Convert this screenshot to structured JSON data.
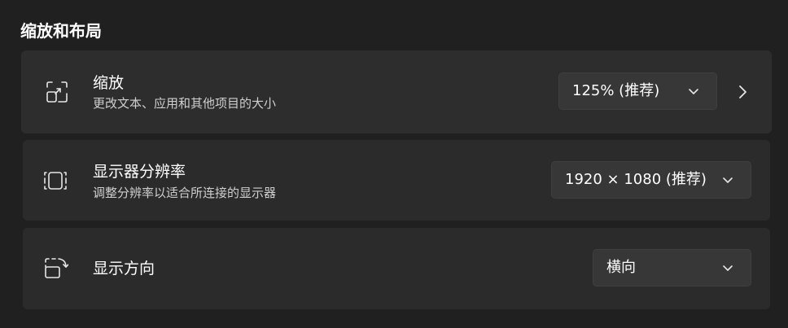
{
  "section": {
    "title": "缩放和布局"
  },
  "scale": {
    "title": "缩放",
    "description": "更改文本、应用和其他项目的大小",
    "icon": "scale-icon",
    "value": "125% (推荐)"
  },
  "resolution": {
    "title": "显示器分辨率",
    "description": "调整分辨率以适合所连接的显示器",
    "icon": "resolution-icon",
    "value": "1920 × 1080 (推荐)"
  },
  "orientation": {
    "title": "显示方向",
    "icon": "orientation-icon",
    "value": "横向"
  },
  "colors": {
    "background": "#202020",
    "card": "#2b2b2b",
    "dropdown": "#373737",
    "text": "#ffffff",
    "subtext": "#cfcfcf"
  }
}
